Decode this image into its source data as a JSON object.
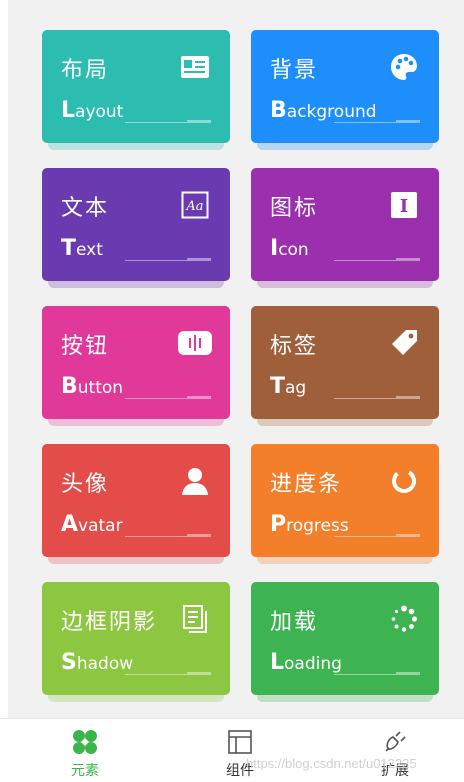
{
  "cards": [
    {
      "key": "layout",
      "title": "布局",
      "sub_first": "L",
      "sub_rest": "ayout",
      "color": "#2cbcb0",
      "icon": "id-card-icon"
    },
    {
      "key": "background",
      "title": "背景",
      "sub_first": "B",
      "sub_rest": "ackground",
      "color": "#1e8ffa",
      "icon": "palette-icon"
    },
    {
      "key": "text",
      "title": "文本",
      "sub_first": "T",
      "sub_rest": "ext",
      "color": "#6a3bb0",
      "icon": "font-aa-icon"
    },
    {
      "key": "icon",
      "title": "图标",
      "sub_first": "I",
      "sub_rest": "con",
      "color": "#9b2fae",
      "icon": "text-cursor-icon"
    },
    {
      "key": "button",
      "title": "按钮",
      "sub_first": "B",
      "sub_rest": "utton",
      "color": "#e0399a",
      "icon": "button-icon"
    },
    {
      "key": "tag",
      "title": "标签",
      "sub_first": "T",
      "sub_rest": "ag",
      "color": "#a05f3b",
      "icon": "tag-icon"
    },
    {
      "key": "avatar",
      "title": "头像",
      "sub_first": "A",
      "sub_rest": "vatar",
      "color": "#e44c4a",
      "icon": "user-icon"
    },
    {
      "key": "progress",
      "title": "进度条",
      "sub_first": "P",
      "sub_rest": "rogress",
      "color": "#f37f2a",
      "icon": "progress-ring-icon"
    },
    {
      "key": "shadow",
      "title": "边框阴影",
      "sub_first": "S",
      "sub_rest": "hadow",
      "color": "#8dc741",
      "icon": "copy-docs-icon"
    },
    {
      "key": "loading",
      "title": "加载",
      "sub_first": "L",
      "sub_rest": "oading",
      "color": "#3db451",
      "icon": "loading-dots-icon"
    }
  ],
  "tabbar": {
    "tabs": [
      {
        "label": "元素",
        "icon": "elements-icon",
        "active": true,
        "color": "#39b54a"
      },
      {
        "label": "组件",
        "icon": "layout-panel-icon",
        "active": false,
        "color": "#333333"
      },
      {
        "label": "扩展",
        "icon": "plugin-icon",
        "active": false,
        "color": "#333333"
      }
    ]
  },
  "watermark": "https://blog.csdn.net/u012225"
}
